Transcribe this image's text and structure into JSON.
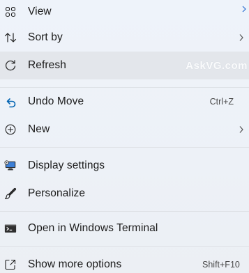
{
  "menu": {
    "items": [
      {
        "label": "View",
        "icon": "view-grid-icon",
        "submenu": true
      },
      {
        "label": "Sort by",
        "icon": "sort-arrows-icon",
        "submenu": true
      },
      {
        "label": "Refresh",
        "icon": "refresh-icon",
        "submenu": false
      },
      {
        "label": "Undo Move",
        "icon": "undo-icon",
        "shortcut": "Ctrl+Z"
      },
      {
        "label": "New",
        "icon": "new-plus-icon",
        "submenu": true
      },
      {
        "label": "Display settings",
        "icon": "display-settings-icon"
      },
      {
        "label": "Personalize",
        "icon": "personalize-brush-icon"
      },
      {
        "label": "Open in Windows Terminal",
        "icon": "terminal-icon"
      },
      {
        "label": "Show more options",
        "icon": "show-more-options-icon",
        "shortcut": "Shift+F10"
      }
    ]
  },
  "watermark": "AskVG.com",
  "colors": {
    "background": "#eef2f8",
    "hover": "#e3e6eb",
    "accent_blue": "#0063b1",
    "separator": "#dde0e5"
  }
}
